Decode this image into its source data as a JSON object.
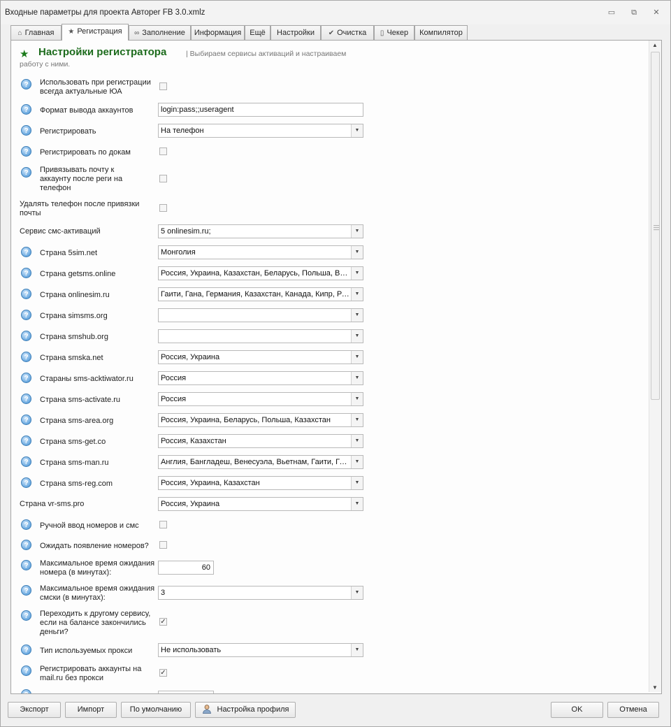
{
  "window": {
    "title": "Входные параметры для проекта Автореr FB 3.0.xmlz",
    "controls": {
      "minimize": "▭",
      "restore": "⧉",
      "close": "✕"
    }
  },
  "tabs": [
    {
      "label": "Главная",
      "icon": "home-icon",
      "glyph": "⌂"
    },
    {
      "label": "Регистрация",
      "icon": "star-icon",
      "glyph": "★",
      "active": true
    },
    {
      "label": "Заполнение",
      "icon": "infinity-icon",
      "glyph": "∞"
    },
    {
      "label": "Информация"
    },
    {
      "label": "Ещё"
    },
    {
      "label": "Настройки"
    },
    {
      "label": "Очистка",
      "icon": "check-icon",
      "glyph": "✔"
    },
    {
      "label": "Чекер",
      "icon": "phone-icon",
      "glyph": "▯"
    },
    {
      "label": "Компилятор"
    }
  ],
  "section": {
    "title": "Настройки регистратора",
    "description": "| Выбираем сервисы активаций и настраиваем работу с ними."
  },
  "fields": {
    "actual_ua": {
      "label": "Использовать при регистрации всегда актуальные ЮА",
      "checked": false
    },
    "account_format": {
      "label": "Формат вывода аккаунтов",
      "value": "login:pass;;useragent"
    },
    "register": {
      "label": "Регистрировать",
      "value": "На телефон"
    },
    "register_docs": {
      "label": "Регистрировать по докам",
      "checked": false
    },
    "bind_mail": {
      "label": "Привязывать почту к аккаунту после реги на телефон",
      "checked": false
    },
    "delete_phone": {
      "label": "Удалять телефон после привязки почты",
      "checked": false
    },
    "sms_service": {
      "label": "Сервис смс-активаций",
      "value": "5 onlinesim.ru;"
    },
    "country_5sim": {
      "label": "Страна 5sim.net",
      "value": "Монголия"
    },
    "country_getsms": {
      "label": "Страна getsms.online",
      "value": "Россия, Украина, Казахстан, Беларусь, Польша, Вьетнам"
    },
    "country_onlinesim": {
      "label": "Страна onlinesim.ru",
      "value": "Гаити, Гана, Германия, Казахстан, Канада, Кипр, Россия"
    },
    "country_simsms": {
      "label": "Страна simsms.org",
      "value": ""
    },
    "country_smshub": {
      "label": "Страна smshub.org",
      "value": ""
    },
    "country_smska": {
      "label": "Страна smska.net",
      "value": "Россия, Украина"
    },
    "country_acktiwator": {
      "label": "Стараны sms-acktiwator.ru",
      "value": "Россия"
    },
    "country_activate": {
      "label": "Страна sms-activate.ru",
      "value": "Россия"
    },
    "country_area": {
      "label": "Страна sms-area.org",
      "value": "Россия, Украина, Беларусь, Польша, Казахстан"
    },
    "country_get": {
      "label": "Страна sms-get.co",
      "value": "Россия, Казахстан"
    },
    "country_man": {
      "label": "Страна sms-man.ru",
      "value": "Англия, Бангладеш, Венесуэла, Вьетнам, Гаити, Гана"
    },
    "country_reg": {
      "label": "Страна sms-reg.com",
      "value": "Россия, Украина, Казахстан"
    },
    "country_vr": {
      "label": "Страна vr-sms.pro",
      "value": "Россия, Украина"
    },
    "manual_input": {
      "label": "Ручной ввод номеров и смс",
      "checked": false
    },
    "wait_numbers": {
      "label": "Ожидать появление номеров?",
      "checked": false
    },
    "max_wait_number": {
      "label": "Максимальное время ожидания номера (в минутах):",
      "value": "60"
    },
    "max_wait_sms": {
      "label": "Максимальное время ожидания смски (в минутах):",
      "value": "3"
    },
    "switch_service": {
      "label": "Переходить к другому сервису, если на балансе закончились деньги?",
      "checked": true
    },
    "proxy_type": {
      "label": "Тип используемых прокси",
      "value": "Не использовать"
    },
    "mail_no_proxy": {
      "label": "Регистрировать аккаунты на mail.ru без прокси",
      "checked": true
    }
  },
  "buttons": {
    "export": "Экспорт",
    "import": "Импорт",
    "default": "По умолчанию",
    "profile": "Настройка профиля",
    "ok": "OK",
    "cancel": "Отмена"
  },
  "colors": {
    "accent_green": "#1c6b1c",
    "help_blue": "#3b7ec0"
  }
}
